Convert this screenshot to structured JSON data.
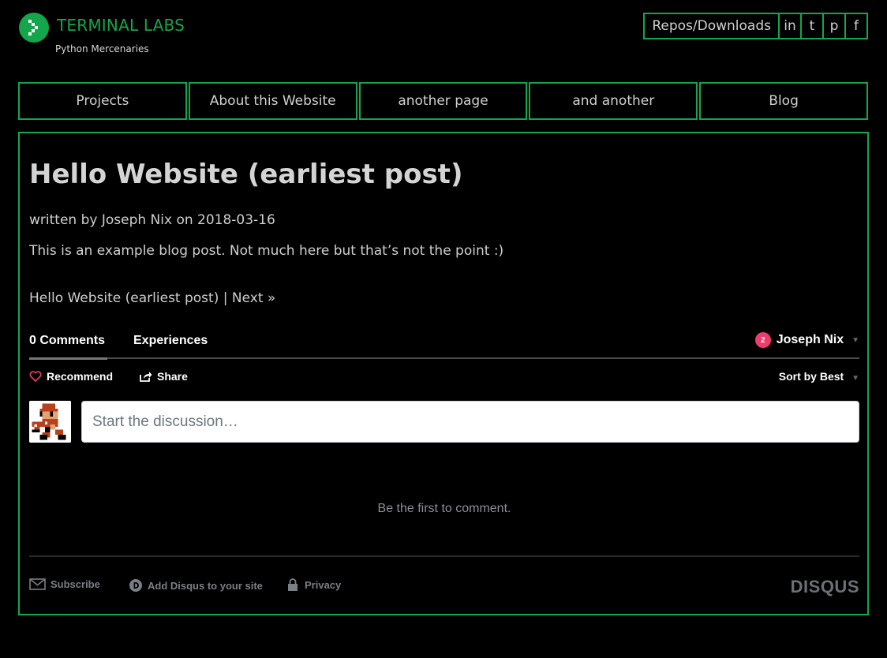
{
  "brand": {
    "title": "TERMINAL LABS",
    "subtitle": "Python Mercenaries",
    "color": "#13a64a"
  },
  "toplinks": [
    {
      "label": "Repos/Downloads"
    },
    {
      "label": "in"
    },
    {
      "label": "t"
    },
    {
      "label": "p"
    },
    {
      "label": "f"
    }
  ],
  "nav": [
    {
      "label": "Projects"
    },
    {
      "label": "About this Website"
    },
    {
      "label": "another page"
    },
    {
      "label": "and another"
    },
    {
      "label": "Blog"
    }
  ],
  "post": {
    "title": "Hello Website (earliest post)",
    "byline": "written by Joseph Nix on 2018-03-16",
    "body": "This is an example blog post. Not much here but that’s not the point :)",
    "pager_current": "Hello Website (earliest post) | ",
    "pager_next": "Next »"
  },
  "disqus": {
    "tab_comments": "0 Comments",
    "tab_experiences": "Experiences",
    "user_badge": "2",
    "user_name": "Joseph Nix",
    "recommend": "Recommend",
    "share": "Share",
    "sort": "Sort by Best",
    "placeholder": "Start the discussion…",
    "empty": "Be the first to comment.",
    "subscribe": "Subscribe",
    "add_disqus": "Add Disqus to your site",
    "privacy": "Privacy",
    "logo": "DISQUS",
    "badge_color": "#f03c6c"
  },
  "icons": [
    "terminal-logo-icon",
    "heart-icon",
    "share-icon",
    "mail-icon",
    "disqus-d-icon",
    "lock-icon",
    "caret-down-icon"
  ]
}
